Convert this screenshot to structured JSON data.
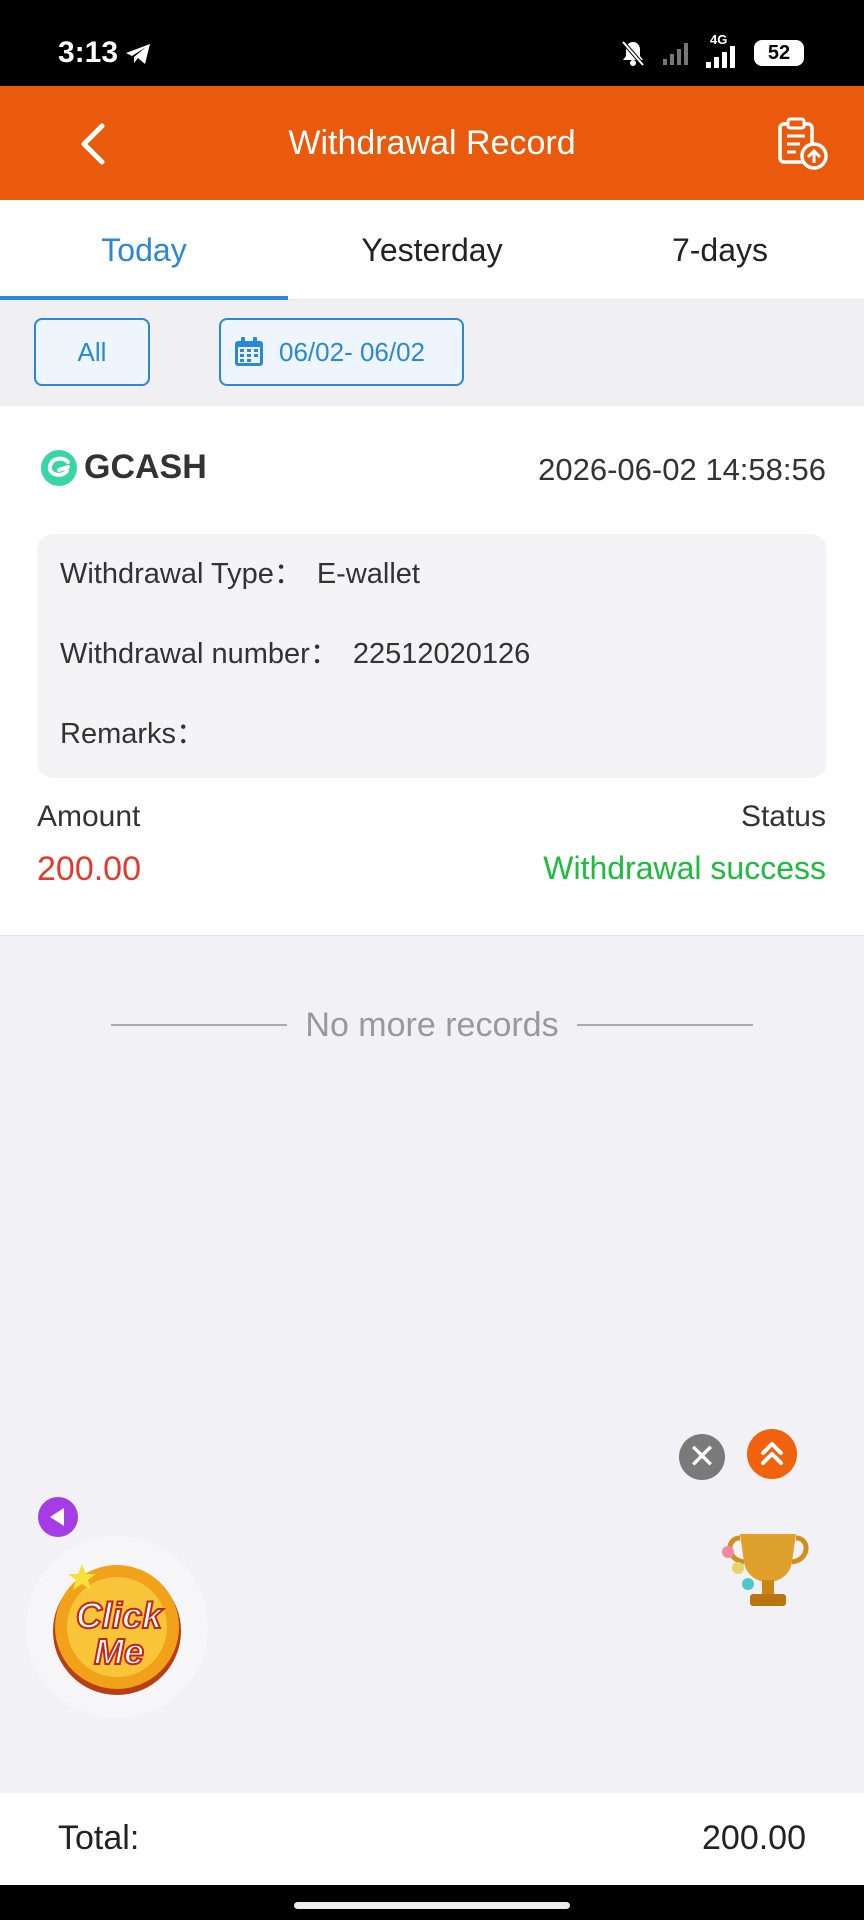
{
  "status_bar": {
    "time": "3:13",
    "network": "4G",
    "battery": "52"
  },
  "header": {
    "title": "Withdrawal Record"
  },
  "tabs": [
    {
      "label": "Today",
      "active": true
    },
    {
      "label": "Yesterday",
      "active": false
    },
    {
      "label": "7-days",
      "active": false
    }
  ],
  "filters": {
    "all_label": "All",
    "date_range": "06/02- 06/02"
  },
  "record": {
    "channel": "GCASH",
    "datetime": "2026-06-02 14:58:56",
    "type_label": "Withdrawal Type：",
    "type_value": "E-wallet",
    "number_label": "Withdrawal number：",
    "number_value": "22512020126",
    "remarks_label": "Remarks：",
    "remarks_value": "",
    "amount_label": "Amount",
    "amount_value": "200.00",
    "status_label": "Status",
    "status_value": "Withdrawal success"
  },
  "list_end_text": "No more records",
  "floating": {
    "close_glyph": "✕",
    "click_me_line1": "Click",
    "click_me_line2": "Me"
  },
  "total": {
    "label": "Total:",
    "value": "200.00"
  },
  "colors": {
    "header": "#ea5a0c",
    "accent": "#2b88d8",
    "amount": "#e23b2e",
    "success": "#1bbd3c"
  }
}
